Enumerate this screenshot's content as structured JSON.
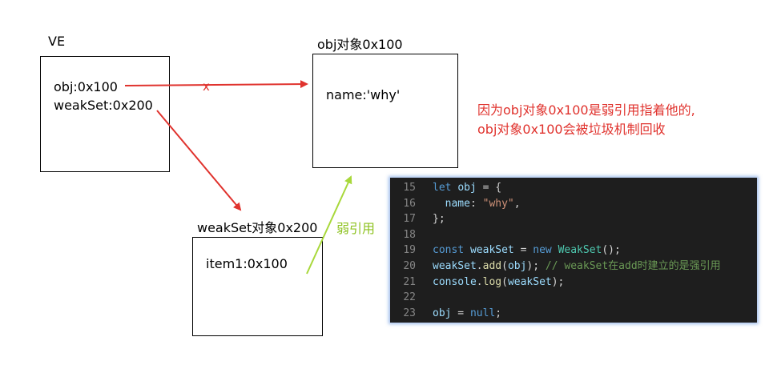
{
  "ve": {
    "title": "VE",
    "obj": "obj:0x100",
    "weakset": "weakSet:0x200"
  },
  "obj_object": {
    "title": "obj对象0x100",
    "name": "name:'why'"
  },
  "weakset_object": {
    "title": "weakSet对象0x200",
    "item": "item1:0x100"
  },
  "weak_ref_label": "弱引用",
  "broken_mark": "x",
  "note": {
    "line1": "因为obj对象0x100是弱引用指着他的,",
    "line2": "obj对象0x100会被垃圾机制回收"
  },
  "colors": {
    "strong_arrow": "#e0332e",
    "weak_arrow": "#a8d83a",
    "note": "#e0332e",
    "code_bg": "#1e1e1e"
  },
  "code": {
    "line_numbers": [
      "15",
      "16",
      "17",
      "18",
      "19",
      "20",
      "21",
      "22",
      "23"
    ],
    "l15": {
      "kw": "let",
      "var": "obj",
      "rest": " = {"
    },
    "l16": {
      "prop": "name",
      "colon": ": ",
      "str": "\"why\"",
      "comma": ","
    },
    "l17": {
      "text": "};"
    },
    "l19": {
      "kw": "const",
      "var": "weakSet",
      "eq": " = ",
      "new": "new",
      "cls": "WeakSet",
      "end": "();"
    },
    "l20": {
      "var": "weakSet",
      "dot": ".",
      "fn": "add",
      "open": "(",
      "arg": "obj",
      "close": "); ",
      "comment": "// weakSet在add时建立的是强引用"
    },
    "l21": {
      "var": "console",
      "dot": ".",
      "fn": "log",
      "open": "(",
      "arg": "weakSet",
      "close": ");"
    },
    "l23": {
      "var": "obj",
      "eq": " = ",
      "kw": "null",
      "end": ";"
    }
  }
}
